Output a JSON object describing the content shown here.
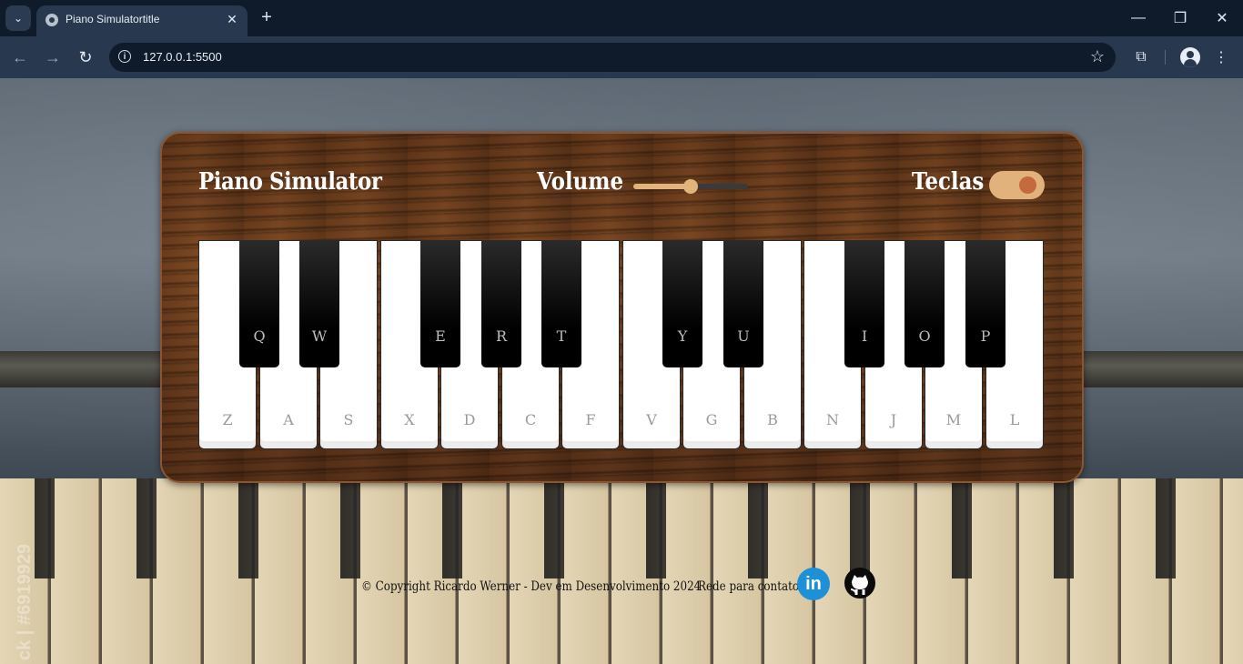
{
  "browser": {
    "tab_title": "Piano Simulatortitle",
    "url": "127.0.0.1:5500"
  },
  "page": {
    "title": "Piano Simulator",
    "volume_label": "Volume",
    "volume_level": 0.5,
    "keys_label": "Teclas",
    "keys_toggle_on": true,
    "white_keys": [
      "Z",
      "A",
      "S",
      "X",
      "D",
      "C",
      "F",
      "V",
      "G",
      "B",
      "N",
      "J",
      "M",
      "L"
    ],
    "black_keys": [
      "Q",
      "W",
      "E",
      "R",
      "T",
      "Y",
      "U",
      "I",
      "O",
      "P"
    ],
    "footer": {
      "copyright": "© Copyright  Ricardo Werner - Dev em Desenvolvimento  2024",
      "contacts_label": "Rede para contatos",
      "linkedin_icon": "linkedin-icon",
      "github_icon": "github-icon"
    },
    "watermark": "ck | #6919929"
  },
  "colors": {
    "toggle_bg": "#e1b27b",
    "toggle_knob": "#c46a3e",
    "linkedin": "#1e90d8"
  }
}
